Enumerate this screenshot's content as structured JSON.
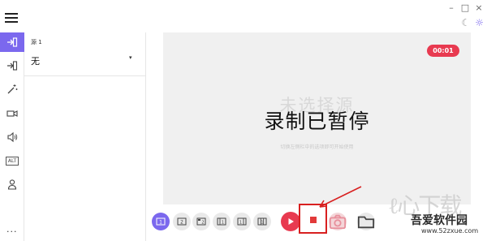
{
  "titlebar": {
    "menu_icon": "hamburger-menu-icon",
    "controls": [
      "–",
      "□",
      "×"
    ],
    "theme_icons": [
      "moon-icon",
      "sun-icon"
    ]
  },
  "rail": {
    "items": [
      {
        "icon": "source-1-icon",
        "active": true
      },
      {
        "icon": "source-2-icon",
        "active": false
      },
      {
        "icon": "magic-wand-icon",
        "active": false
      },
      {
        "icon": "video-camera-icon",
        "active": false
      },
      {
        "icon": "speaker-icon",
        "active": false
      },
      {
        "icon": "alt-icon",
        "label": "ALT",
        "active": false
      },
      {
        "icon": "user-icon",
        "active": false
      }
    ],
    "more": "..."
  },
  "panel": {
    "source_label": "源 1",
    "source_value": "无",
    "caret": "▾"
  },
  "preview": {
    "timer": "00:01",
    "no_source": "未选择源",
    "paused": "录制已暂停",
    "hint": "切换左侧栏中的选项即可开始使用"
  },
  "toolbar": {
    "layout_buttons": [
      "1",
      "2",
      "2",
      "1",
      "1",
      "1"
    ],
    "play_icon": "play-icon",
    "stop_icon": "stop-icon",
    "camera_icon": "camera-icon",
    "folder_icon": "folder-icon"
  },
  "watermark": {
    "logo": "ℓ心下载",
    "name": "吾爱软件园",
    "url": "www.52zxue.com"
  },
  "colors": {
    "accent": "#7b68ee",
    "record_red": "#e83a50",
    "highlight_red": "#d82020"
  }
}
